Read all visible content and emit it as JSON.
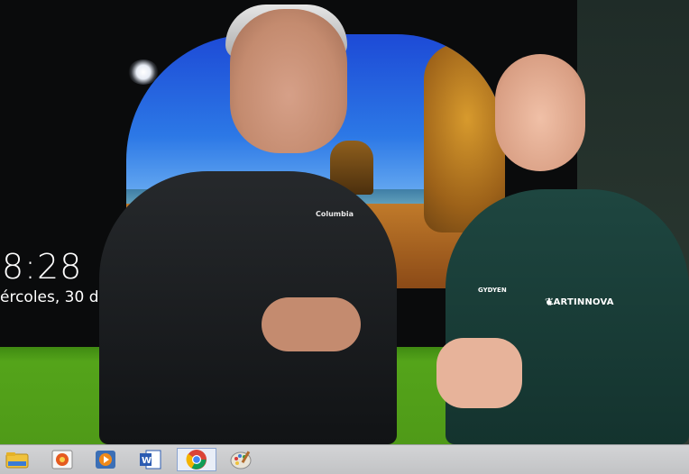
{
  "lockscreen": {
    "time": "8:28",
    "date": "ércoles, 30 d"
  },
  "clothing_text": {
    "man_jacket_logo": "Columbia",
    "woman_hoodie_brand": "LARTINNOVA",
    "woman_hoodie_left": "GYDYEN"
  },
  "taskbar": {
    "icons": [
      {
        "name": "file-explorer-icon",
        "color": "#f0c23b"
      },
      {
        "name": "photo-viewer-icon",
        "color": "#e55a1f"
      },
      {
        "name": "media-player-icon",
        "color": "#f08a1a"
      },
      {
        "name": "word-icon",
        "color": "#2b5bb2"
      },
      {
        "name": "chrome-icon",
        "color": "#4285f4",
        "active": true
      },
      {
        "name": "paint-icon",
        "color": "#7aa7d8"
      }
    ]
  }
}
